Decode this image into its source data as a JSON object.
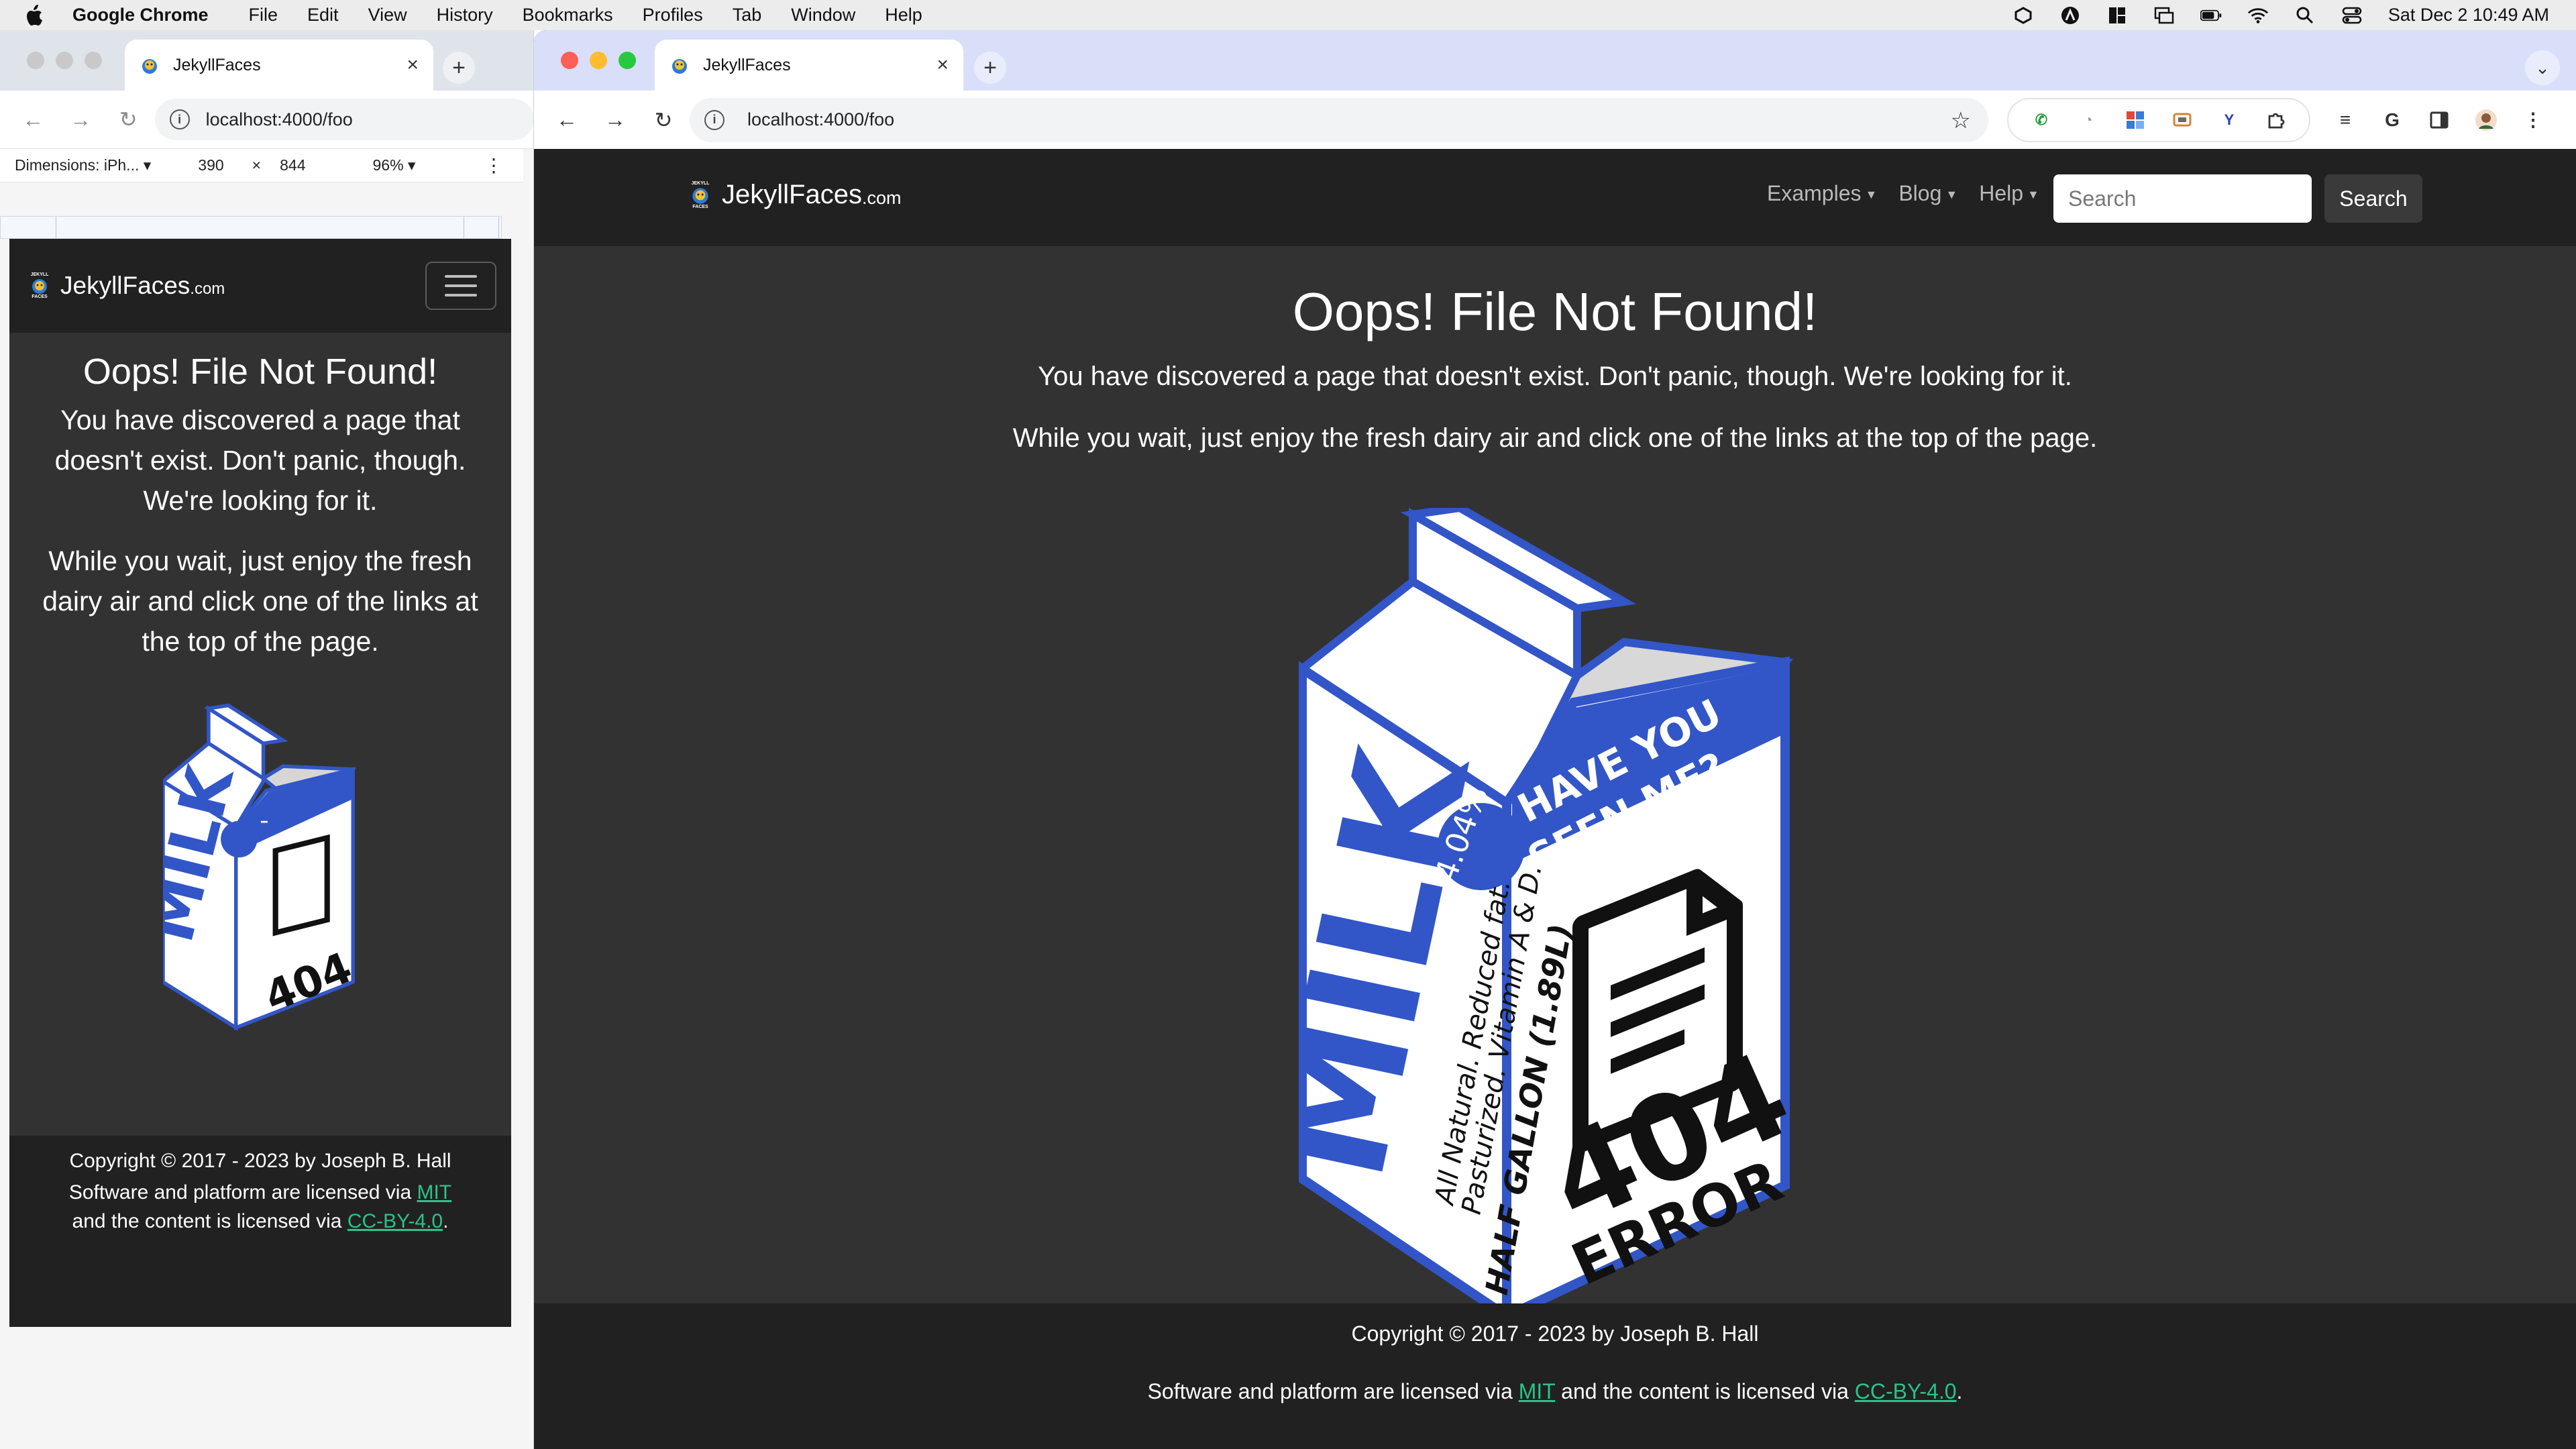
{
  "menubar": {
    "app": "Google Chrome",
    "items": [
      "File",
      "Edit",
      "View",
      "History",
      "Bookmarks",
      "Profiles",
      "Tab",
      "Window",
      "Help"
    ],
    "clock": "Sat Dec 2  10:49 AM"
  },
  "left_window": {
    "tab_title": "JekyllFaces",
    "url": "localhost:4000/foo",
    "devtools": {
      "dimensions_label": "Dimensions: iPh...",
      "width": "390",
      "times": "×",
      "height": "844",
      "zoom": "96%"
    }
  },
  "right_window": {
    "tab_title": "JekyllFaces",
    "url": "localhost:4000/foo"
  },
  "site": {
    "brand": "JekyllFaces",
    "brand_domain": ".com",
    "logo_text": "JEKYLL",
    "logo_subtext": "FACES",
    "nav": {
      "examples": "Examples",
      "blog": "Blog",
      "help": "Help"
    },
    "search_placeholder": "Search",
    "search_button": "Search",
    "heading": "Oops! File Not Found!",
    "paragraph1": "You have discovered a page that doesn't exist. Don't panic, though. We're looking for it.",
    "paragraph2": "While you wait, just enjoy the fresh dairy air and click one of the links at the top of the page.",
    "carton": {
      "milk": "MILK",
      "badge": "4.04%",
      "slogan_line1": "HAVE YOU",
      "slogan_line2": "SEEN ME?",
      "side_line1": "All Natural. Reduced fat.",
      "side_line2": "Pasturized. Vitamin A & D.",
      "side_line3": "HALF GALLON (1.89L)",
      "code": "404",
      "error": "ERROR"
    },
    "footer": {
      "copyright": "Copyright © 2017 - 2023 by Joseph B. Hall",
      "license_prefix": "Software and platform are licensed via ",
      "mit": "MIT",
      "license_middle": " and the content is licensed via ",
      "license_mid_mobile": "and the content is licensed via ",
      "cc": "CC-BY-4.0",
      "period": "."
    }
  },
  "colors": {
    "page_bg": "#323233",
    "navbar_bg": "#212121",
    "link": "#2ac38a",
    "carton_blue": "#3256c7",
    "close_red": "#fe5f57",
    "minimize_yellow": "#febc2e",
    "zoom_green": "#28c840"
  }
}
